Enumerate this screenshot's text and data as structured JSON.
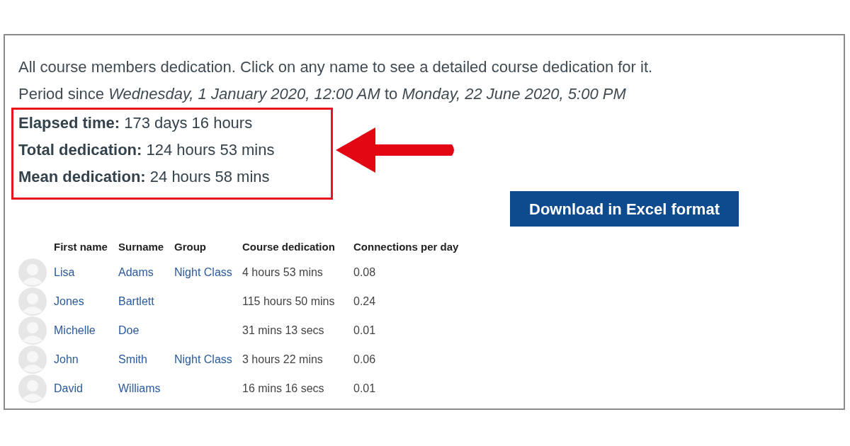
{
  "intro": "All course members dedication. Click on any name to see a detailed course dedication for it.",
  "period": "Period since *Wednesday, 1 January 2020, 12:00 AM* to *Monday, 22 June 2020, 5:00 PM*",
  "stats": [
    "**Elapsed time:** 173 days 16 hours",
    "**Total dedication:** 124 hours 53 mins",
    "**Mean dedication:** 24 hours 58 mins"
  ],
  "download_button": "Download in Excel format",
  "table": {
    "columns": [
      "First name",
      "Surname",
      "Group",
      "Course dedication",
      "Connections per day"
    ],
    "rows": [
      {
        "first_name": "Lisa",
        "surname": "Adams",
        "group": "Night Class",
        "dedication": "4 hours 53 mins",
        "connections": "0.08"
      },
      {
        "first_name": "Jones",
        "surname": "Bartlett",
        "dedication": "115 hours 50 mins",
        "connections": "0.24"
      },
      {
        "first_name": "Michelle",
        "surname": "Doe",
        "dedication": "31 mins 13 secs",
        "connections": "0.01"
      },
      {
        "first_name": "John",
        "surname": "Smith",
        "group": "Night Class",
        "dedication": "3 hours 22 mins",
        "connections": "0.06"
      },
      {
        "first_name": "David",
        "surname": "Williams",
        "dedication": "16 mins 16 secs",
        "connections": "0.01"
      }
    ]
  }
}
